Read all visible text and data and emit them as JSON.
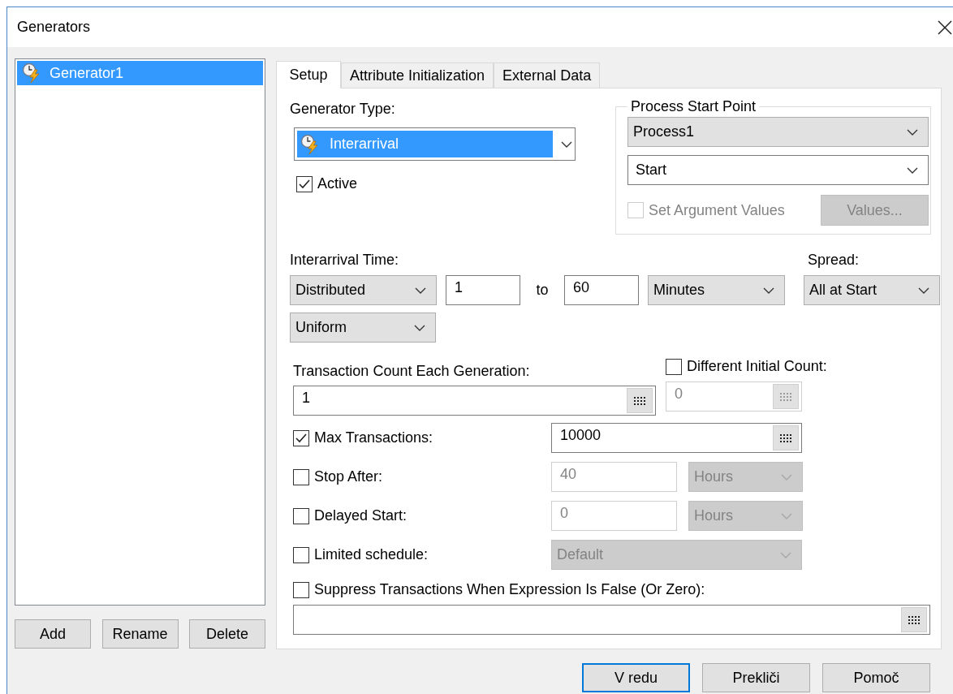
{
  "window": {
    "title": "Generators"
  },
  "generator_list": {
    "items": [
      {
        "label": "Generator1",
        "selected": true
      }
    ],
    "buttons": [
      "Add",
      "Rename",
      "Delete"
    ]
  },
  "tabs": [
    {
      "label": "Setup",
      "selected": true
    },
    {
      "label": "Attribute Initialization",
      "selected": false
    },
    {
      "label": "External Data",
      "selected": false
    }
  ],
  "setup": {
    "generator_type": {
      "label": "Generator Type:",
      "value": "Interarrival"
    },
    "active": {
      "label": "Active",
      "checked": true,
      "disabled": false
    },
    "process_start_point": {
      "title": "Process Start Point",
      "process": {
        "value": "Process1",
        "kind": "list",
        "disabled": false
      },
      "entry_point": {
        "value": "Start",
        "kind": "edit",
        "disabled": false
      },
      "set_argument_values": {
        "label": "Set Argument Values",
        "checked": false,
        "disabled": true
      },
      "values_button": {
        "label": "Values...",
        "disabled": true
      }
    },
    "interarrival_time": {
      "label": "Interarrival Time:",
      "mode": {
        "value": "Distributed",
        "kind": "list",
        "disabled": false
      },
      "from": {
        "value": "1",
        "kind": "text",
        "disabled": false
      },
      "to_label": "to",
      "to": {
        "value": "60",
        "kind": "text",
        "disabled": false
      },
      "unit": {
        "value": "Minutes",
        "kind": "list",
        "disabled": false
      },
      "distribution": {
        "value": "Uniform",
        "kind": "list",
        "disabled": false
      }
    },
    "spread": {
      "label": "Spread:",
      "value": "All at Start",
      "kind": "list",
      "disabled": false
    },
    "transaction_count": {
      "label": "Transaction Count Each Generation:",
      "field": {
        "value": "1",
        "kind": "calc",
        "disabled": false
      }
    },
    "different_initial_count": {
      "label": "Different Initial Count:",
      "checked": false,
      "disabled": false,
      "field": {
        "value": "0",
        "kind": "calc",
        "disabled": true
      }
    },
    "limits": [
      {
        "label": "Max Transactions:",
        "checked": true,
        "disabled": false,
        "controls": [
          {
            "value": "10000",
            "kind": "calc",
            "disabled": false
          }
        ]
      },
      {
        "label": "Stop After:",
        "checked": false,
        "disabled": false,
        "controls": [
          {
            "value": "40",
            "kind": "text",
            "disabled": true
          },
          {
            "value": "Hours",
            "kind": "list",
            "disabled": true
          }
        ]
      },
      {
        "label": "Delayed Start:",
        "checked": false,
        "disabled": false,
        "controls": [
          {
            "value": "0",
            "kind": "text",
            "disabled": true
          },
          {
            "value": "Hours",
            "kind": "list",
            "disabled": true
          }
        ]
      },
      {
        "label": "Limited schedule:",
        "checked": false,
        "disabled": false,
        "controls": [
          {
            "value": "Default",
            "kind": "list",
            "disabled": true
          }
        ]
      }
    ],
    "suppress": {
      "label": "Suppress Transactions When Expression Is False (Or Zero):",
      "checked": false,
      "disabled": false,
      "field": {
        "kind": "calc",
        "disabled": false
      }
    }
  },
  "dialog_buttons": [
    {
      "label": "V redu",
      "default": true
    },
    {
      "label": "Prekliči",
      "default": false
    },
    {
      "label": "Pomoč",
      "default": false
    }
  ]
}
